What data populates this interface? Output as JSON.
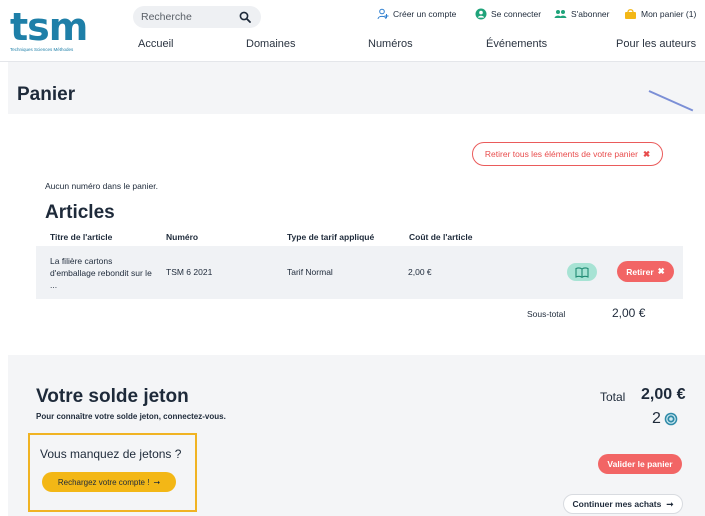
{
  "header": {
    "logo_text": "tsm",
    "logo_subtitle": "Techniques Sciences Méthodes",
    "search_placeholder": "Recherche",
    "top_links": {
      "create_account": "Créer un compte",
      "login": "Se connecter",
      "subscribe": "S'abonner",
      "cart": "Mon panier (1)"
    },
    "nav": [
      "Accueil",
      "Domaines",
      "Numéros",
      "Événements",
      "Pour les auteurs"
    ]
  },
  "page": {
    "title": "Panier"
  },
  "cart": {
    "clear_all_label": "Retirer tous les éléments de votre panier",
    "empty_issues_msg": "Aucun numéro dans le panier.",
    "articles_heading": "Articles",
    "columns": [
      "Titre de l'article",
      "Numéro",
      "Type de tarif appliqué",
      "Coût de l'article"
    ],
    "rows": [
      {
        "title": "La filière cartons d'emballage rebondit sur le ...",
        "issue": "TSM 6 2021",
        "rate": "Tarif Normal",
        "cost": "2,00 €",
        "remove_label": "Retirer"
      }
    ],
    "subtotal_label": "Sous-total",
    "subtotal_value": "2,00 €"
  },
  "tokens": {
    "title": "Votre solde jeton",
    "subtitle": "Pour connaître votre solde jeton, connectez-vous.",
    "total_label": "Total",
    "total_value": "2,00 €",
    "token_count": "2",
    "promo_title": "Vous manquez de jetons ?",
    "recharge_label": "Rechargez votre compte !",
    "validate_label": "Valider le panier",
    "continue_label": "Continuer mes achats"
  },
  "colors": {
    "brand": "#1e7fa8",
    "danger": "#f26565",
    "accent_yellow": "#f3b716",
    "mint": "#a7e3d4",
    "text": "#1e2a3a"
  }
}
